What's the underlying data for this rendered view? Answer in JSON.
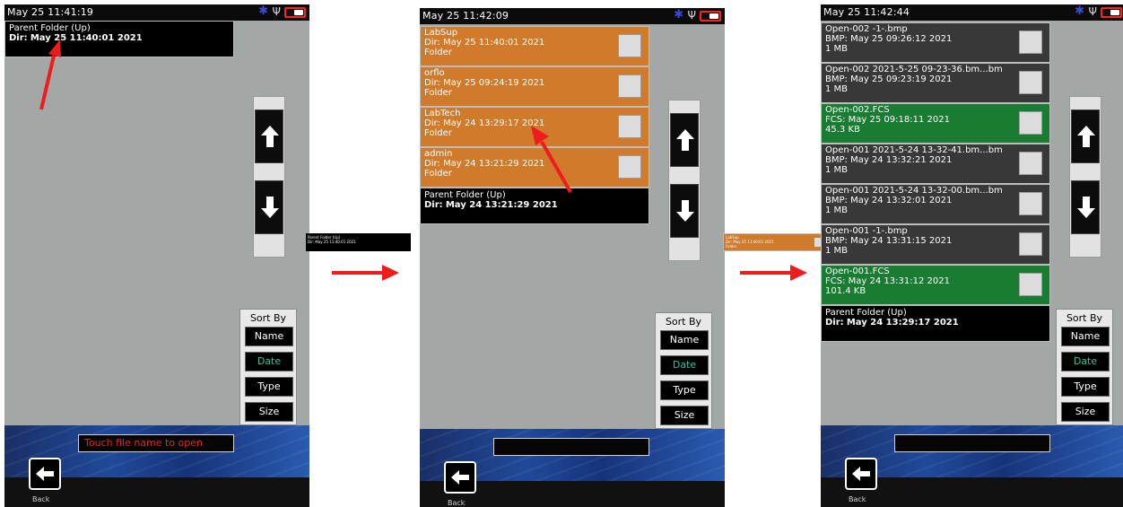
{
  "colors": {
    "folder_row": "#d07a2c",
    "file_row": "#383838",
    "fcs_row": "#1a7c32",
    "parent_row": "#000000",
    "panel_bg": "#a3a7a6",
    "active_sort": "#35c0a0",
    "message_text": "#e32626",
    "annotation_arrow": "#ef1c1c",
    "bluetooth": "#3a4bd8",
    "battery": "#ff2020"
  },
  "icons": [
    "bluetooth-icon",
    "usb-icon",
    "battery-icon",
    "up-arrow-icon",
    "down-arrow-icon",
    "back-arrow-icon",
    "annotation-arrow",
    "flow-arrow"
  ],
  "screen1": {
    "status_time": "May 25 11:41:19",
    "rows": [
      {
        "name": "Parent Folder (Up)",
        "label": "Dir:",
        "date": "May 25 11:40:01 2021"
      }
    ],
    "message": "Touch file name to open",
    "back_label": "Back"
  },
  "screen2": {
    "status_time": "May 25 11:42:09",
    "rows": [
      {
        "name": "LabSup",
        "label": "Dir:",
        "date": "May 25 11:40:01 2021",
        "extra": "Folder"
      },
      {
        "name": "orflo",
        "label": "Dir:",
        "date": "May 25 09:24:19 2021",
        "extra": "Folder"
      },
      {
        "name": "LabTech",
        "label": "Dir:",
        "date": "May 24 13:29:17 2021",
        "extra": "Folder"
      },
      {
        "name": "admin",
        "label": "Dir:",
        "date": "May 24 13:21:29 2021",
        "extra": "Folder"
      },
      {
        "name": "Parent Folder (Up)",
        "label": "Dir:",
        "date": "May 24 13:21:29 2021"
      }
    ],
    "message": "",
    "back_label": "Back"
  },
  "screen3": {
    "status_time": "May 25 11:42:44",
    "rows": [
      {
        "name": "Open-002 -1-.bmp",
        "label": "BMP:",
        "date": "May 25 09:26:12 2021",
        "extra": "1 MB"
      },
      {
        "name": "Open-002 2021-5-25 09-23-36.bm...bm",
        "label": "BMP:",
        "date": "May 25 09:23:19 2021",
        "extra": "1 MB"
      },
      {
        "name": "Open-002.FCS",
        "label": "FCS:",
        "date": "May 25 09:18:11 2021",
        "extra": "45.3 KB"
      },
      {
        "name": "Open-001 2021-5-24 13-32-41.bm...bm",
        "label": "BMP:",
        "date": "May 24 13:32:21 2021",
        "extra": "1 MB"
      },
      {
        "name": "Open-001 2021-5-24 13-32-00.bm...bm",
        "label": "BMP:",
        "date": "May 24 13:32:01 2021",
        "extra": "1 MB"
      },
      {
        "name": "Open-001 -1-.bmp",
        "label": "BMP:",
        "date": "May 24 13:31:15 2021",
        "extra": "1 MB"
      },
      {
        "name": "Open-001.FCS",
        "label": "FCS:",
        "date": "May 24 13:31:12 2021",
        "extra": "101.4 KB"
      },
      {
        "name": "Parent Folder (Up)",
        "label": "Dir:",
        "date": "May 24 13:29:17 2021"
      }
    ],
    "message": "",
    "back_label": "Back"
  },
  "sort": {
    "title": "Sort By",
    "options": [
      "Name",
      "Date",
      "Type",
      "Size"
    ],
    "selected": "Date"
  },
  "mini1": {
    "line1": "Parent Folder (Up)",
    "line2": "Dir: May 25 11:40:01 2021"
  },
  "mini2": {
    "line1": "LabSup",
    "line2": "Dir: May 25 11:40:01 2021",
    "line3": "Folder"
  }
}
